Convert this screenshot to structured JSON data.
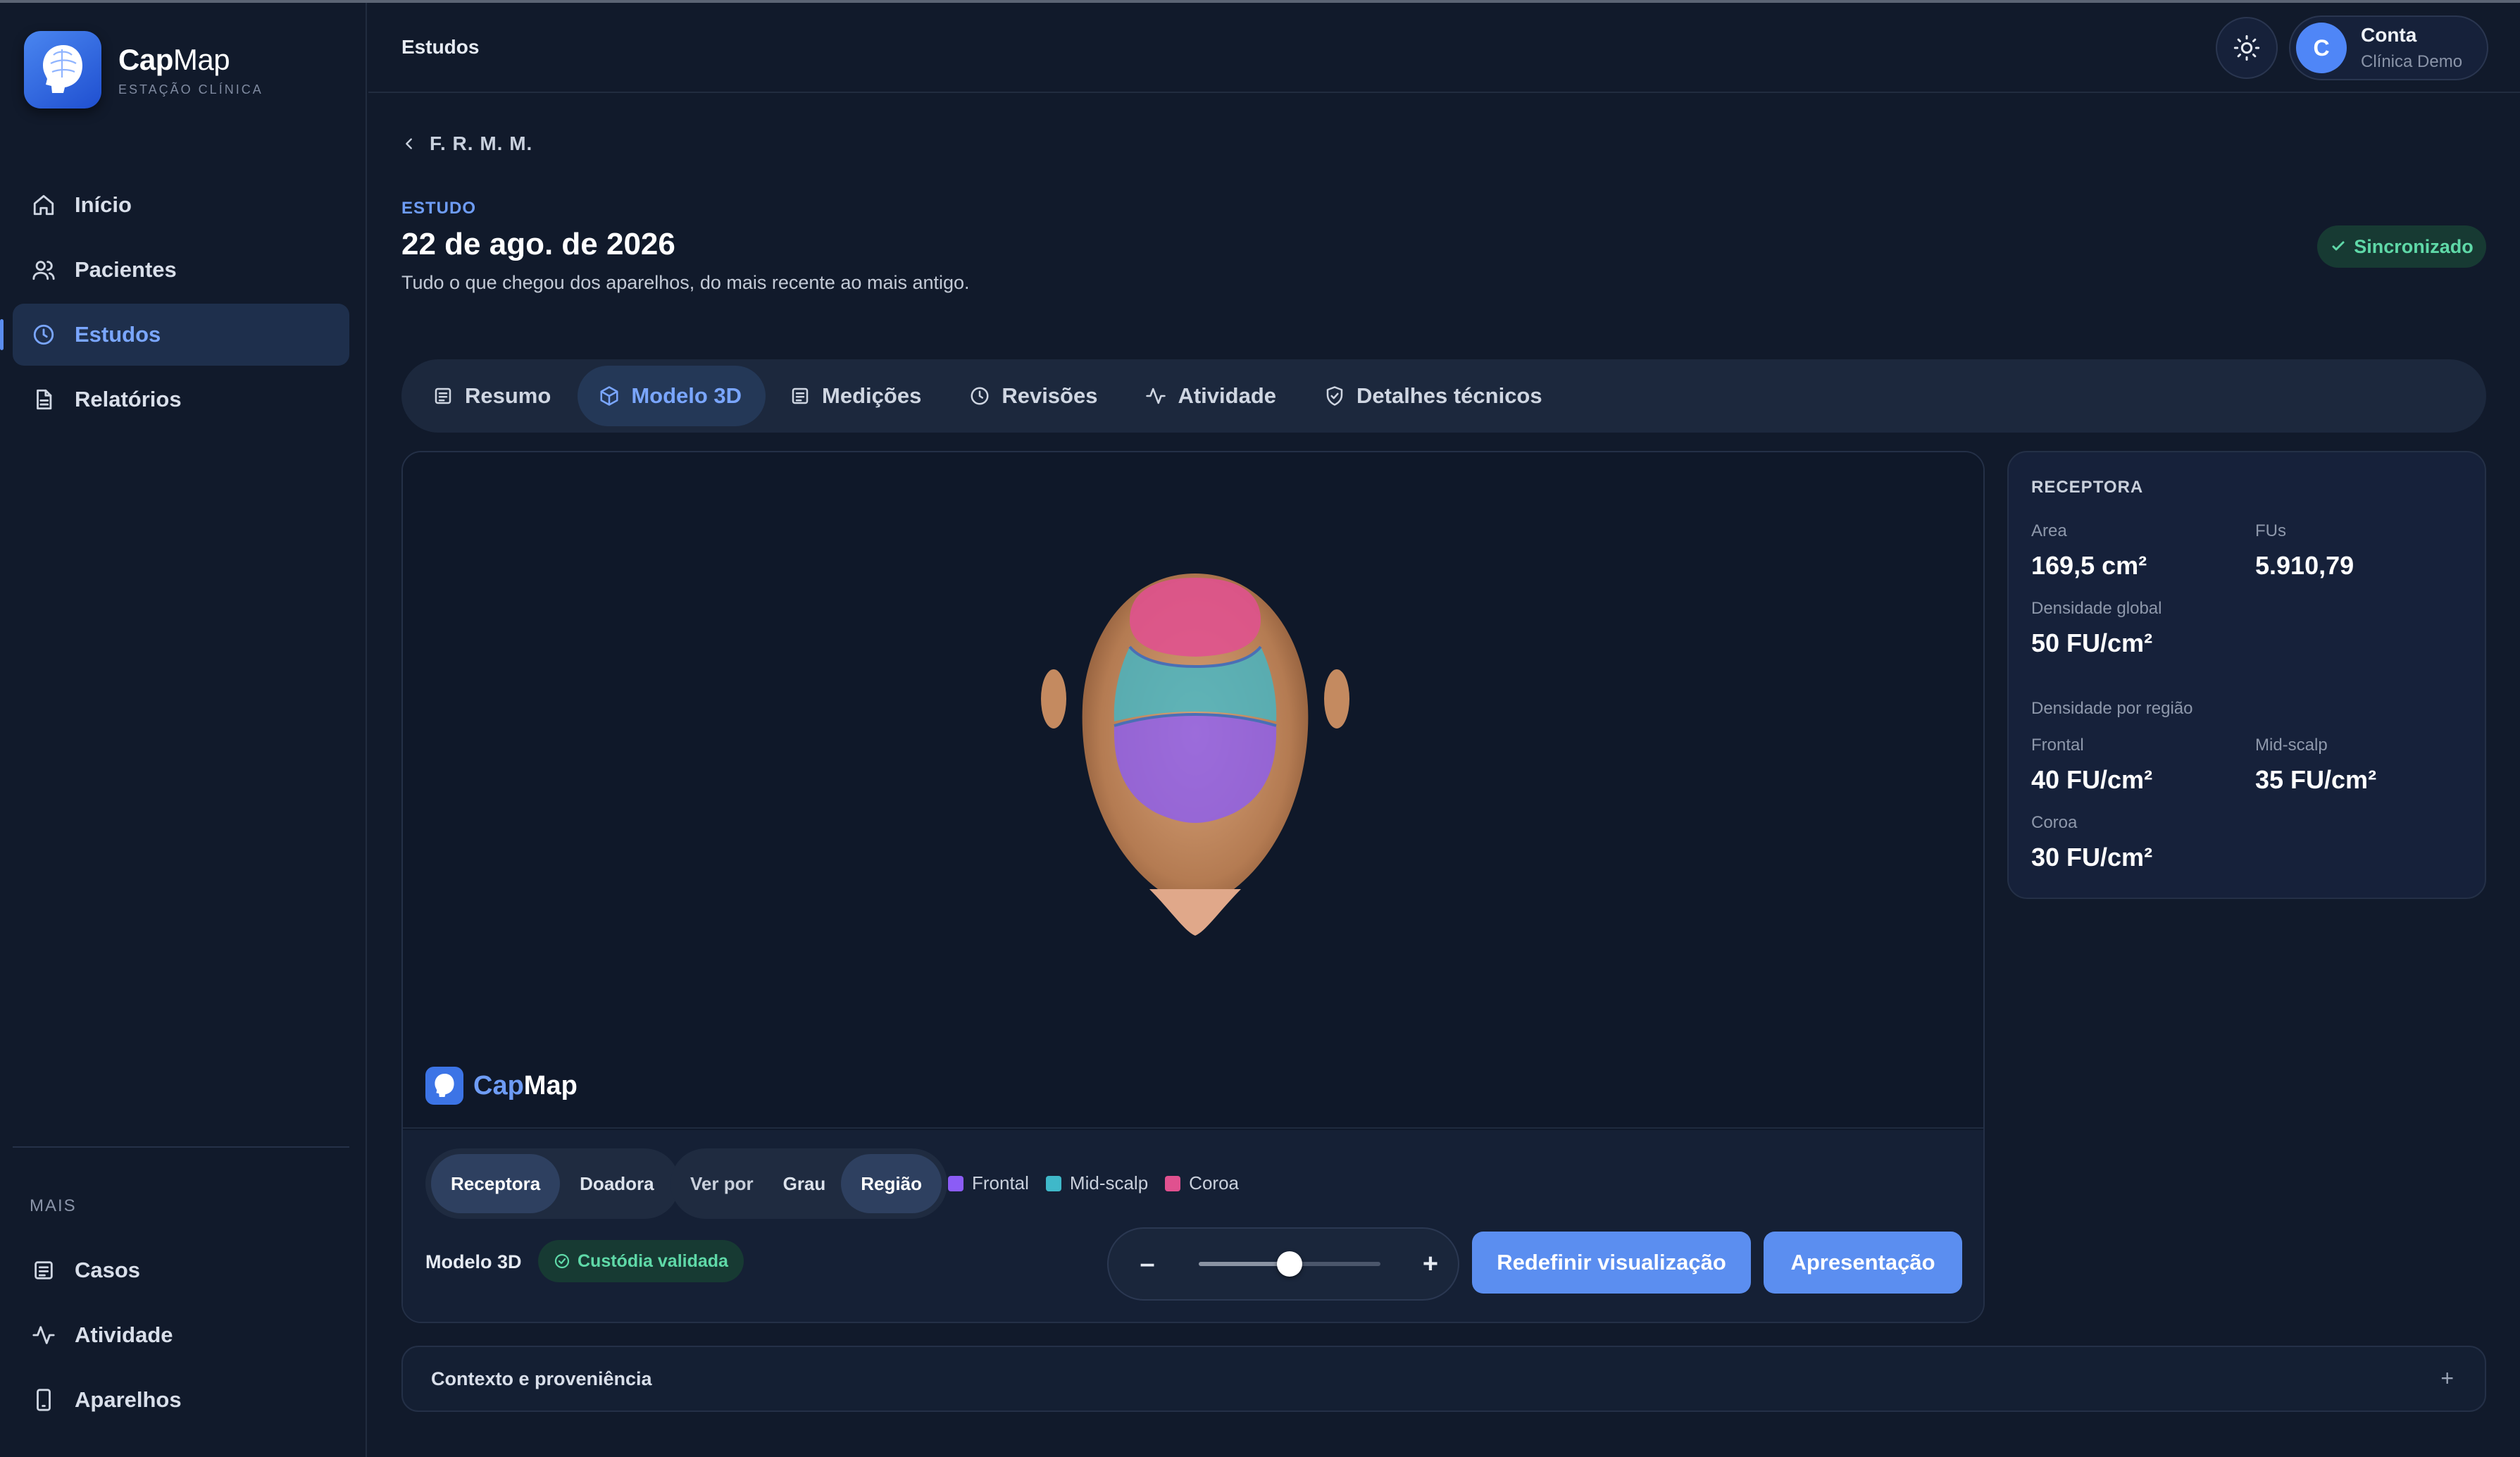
{
  "brand": {
    "name_bold": "Cap",
    "name_rest": "Map",
    "subtitle": "ESTAÇÃO CLÍNICA"
  },
  "sidebar": {
    "items": [
      {
        "label": "Início",
        "icon": "home-icon"
      },
      {
        "label": "Pacientes",
        "icon": "users-icon"
      },
      {
        "label": "Estudos",
        "icon": "clock-icon",
        "active": true
      },
      {
        "label": "Relatórios",
        "icon": "document-icon"
      }
    ],
    "section_label": "MAIS",
    "more_items": [
      {
        "label": "Casos",
        "icon": "list-icon"
      },
      {
        "label": "Atividade",
        "icon": "activity-icon"
      },
      {
        "label": "Aparelhos",
        "icon": "smartphone-icon"
      }
    ]
  },
  "topbar": {
    "breadcrumb": "Estudos",
    "account": {
      "initial": "C",
      "name": "Conta",
      "org": "Clínica Demo"
    }
  },
  "header": {
    "back_label": "F. R. M. M.",
    "eyebrow": "ESTUDO",
    "title": "22 de ago. de 2026",
    "subtitle": "Tudo o que chegou dos aparelhos, do mais recente ao mais antigo.",
    "status": "Sincronizado"
  },
  "tabs": [
    {
      "label": "Resumo",
      "icon": "list-icon"
    },
    {
      "label": "Modelo 3D",
      "icon": "cube-icon",
      "active": true
    },
    {
      "label": "Medições",
      "icon": "list-icon"
    },
    {
      "label": "Revisões",
      "icon": "clock-icon"
    },
    {
      "label": "Atividade",
      "icon": "activity-icon"
    },
    {
      "label": "Detalhes técnicos",
      "icon": "shield-icon"
    }
  ],
  "viewer": {
    "watermark_cap": "Cap",
    "watermark_map": "Map",
    "area_toggle": {
      "receptora": "Receptora",
      "doadora": "Doadora",
      "selected": "Receptora"
    },
    "view_by": {
      "label": "Ver por",
      "grau": "Grau",
      "regiao": "Região",
      "selected": "Região"
    },
    "legend": [
      {
        "label": "Frontal",
        "color": "#8b5cf6"
      },
      {
        "label": "Mid-scalp",
        "color": "#3fb8c9"
      },
      {
        "label": "Coroa",
        "color": "#e0518f"
      }
    ],
    "model_label": "Modelo 3D",
    "custody_badge": "Custódia validada",
    "zoom": {
      "minus": "–",
      "plus": "+",
      "level": 0.5
    },
    "reset_button": "Redefinir visualização",
    "present_button": "Apresentação"
  },
  "panel": {
    "title": "RECEPTORA",
    "area_label": "Area",
    "area_value": "169,5 cm²",
    "fus_label": "FUs",
    "fus_value": "5.910,79",
    "density_label": "Densidade global",
    "density_value": "50 FU/cm²",
    "region_label": "Densidade por região",
    "frontal_label": "Frontal",
    "frontal_value": "40 FU/cm²",
    "midscalp_label": "Mid-scalp",
    "midscalp_value": "35 FU/cm²",
    "coroa_label": "Coroa",
    "coroa_value": "30 FU/cm²"
  },
  "context": {
    "label": "Contexto e proveniência",
    "toggle": "+"
  },
  "colors": {
    "accent": "#5b8ef0",
    "background": "#111a2b",
    "success": "#5fd9a8"
  }
}
